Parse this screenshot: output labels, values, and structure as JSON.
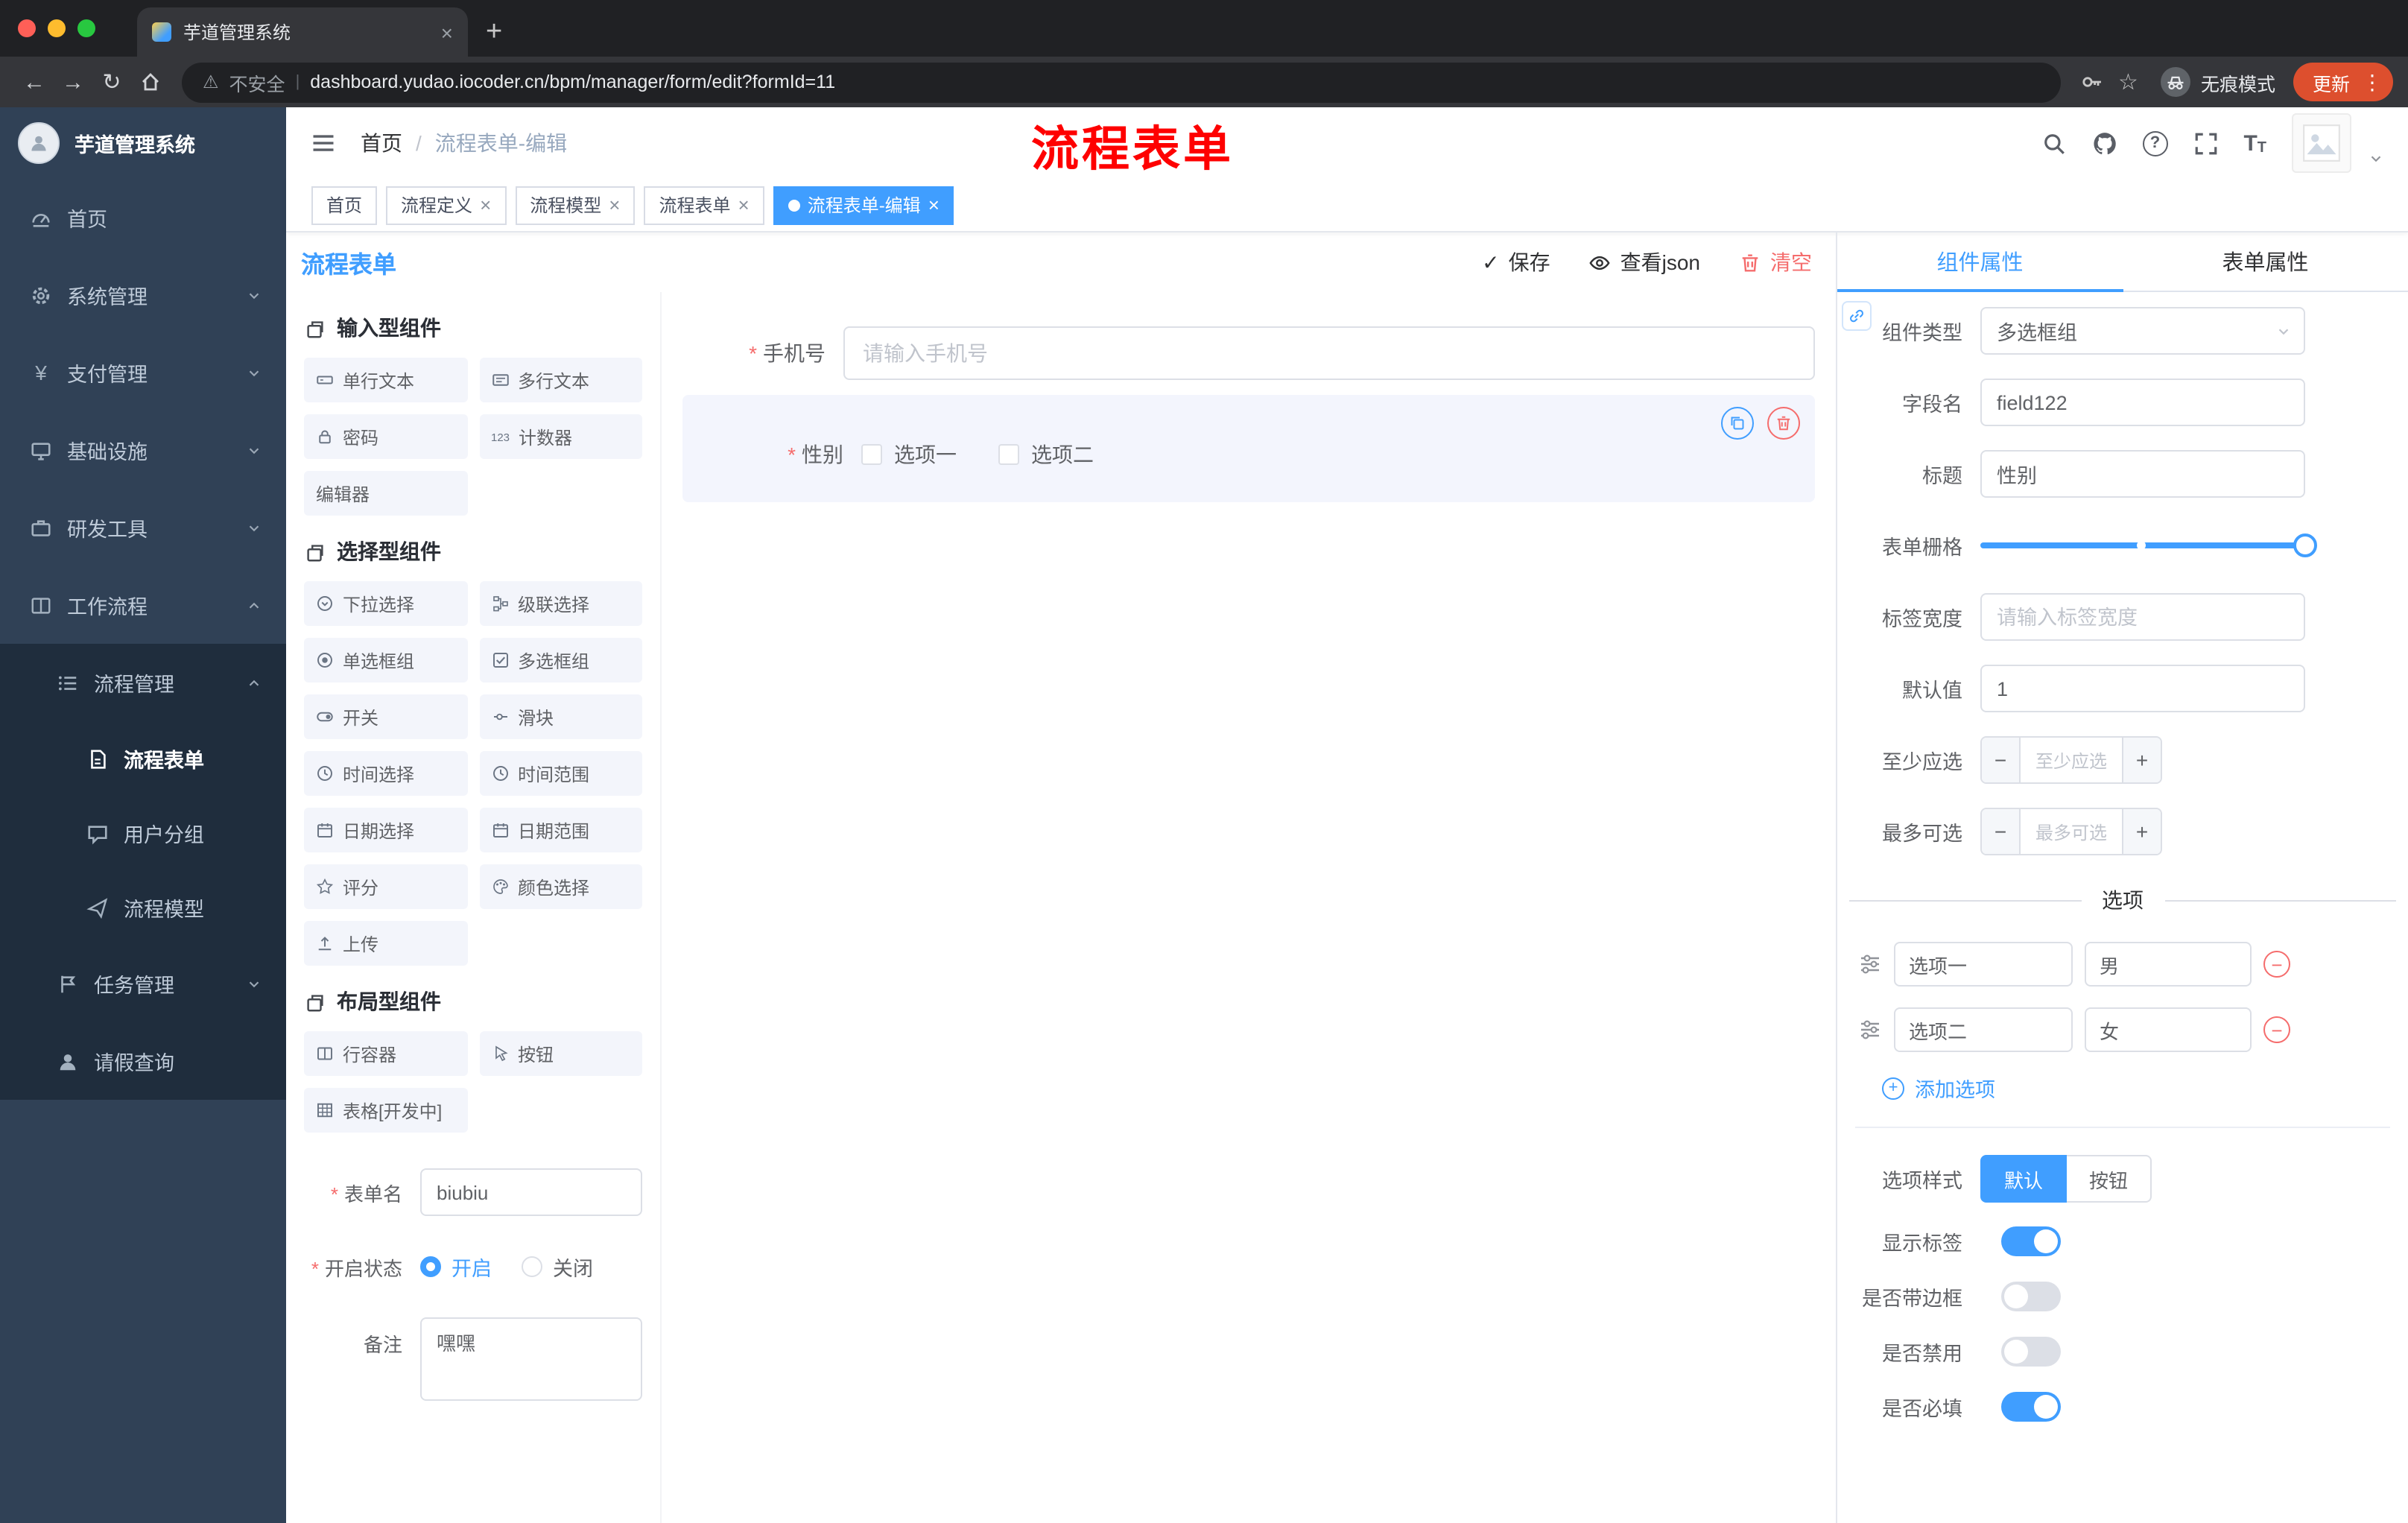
{
  "colors": {
    "accent": "#409eff",
    "danger": "#f56c6c",
    "annotation": "#ff0000",
    "sidebar_bg": "#304156",
    "update_badge": "#dd4f2e"
  },
  "browser": {
    "tab_title": "芋道管理系统",
    "security_label": "不安全",
    "url": "dashboard.yudao.iocoder.cn/bpm/manager/form/edit?formId=11",
    "incognito_label": "无痕模式",
    "update_label": "更新"
  },
  "sidebar": {
    "logo_title": "芋道管理系统",
    "items": [
      {
        "label": "首页"
      },
      {
        "label": "系统管理"
      },
      {
        "label": "支付管理"
      },
      {
        "label": "基础设施"
      },
      {
        "label": "研发工具"
      },
      {
        "label": "工作流程"
      }
    ],
    "submenu": {
      "process_mgmt": {
        "label": "流程管理",
        "children": [
          {
            "label": "流程表单"
          },
          {
            "label": "用户分组"
          },
          {
            "label": "流程模型"
          }
        ]
      },
      "task_mgmt": {
        "label": "任务管理"
      },
      "leave_query": {
        "label": "请假查询"
      }
    }
  },
  "header": {
    "breadcrumb": [
      "首页",
      "流程表单-编辑"
    ],
    "annotation": "流程表单"
  },
  "tags": [
    {
      "label": "首页",
      "closable": false,
      "active": false
    },
    {
      "label": "流程定义",
      "closable": true,
      "active": false
    },
    {
      "label": "流程模型",
      "closable": true,
      "active": false
    },
    {
      "label": "流程表单",
      "closable": true,
      "active": false
    },
    {
      "label": "流程表单-编辑",
      "closable": true,
      "active": true
    }
  ],
  "designer": {
    "title": "流程表单",
    "actions": {
      "save": "保存",
      "view_json": "查看json",
      "clear": "清空"
    },
    "palette": {
      "sections": [
        {
          "title": "输入型组件",
          "items": [
            "单行文本",
            "多行文本",
            "密码",
            "计数器",
            "编辑器"
          ]
        },
        {
          "title": "选择型组件",
          "items": [
            "下拉选择",
            "级联选择",
            "单选框组",
            "多选框组",
            "开关",
            "滑块",
            "时间选择",
            "时间范围",
            "日期选择",
            "日期范围",
            "评分",
            "颜色选择",
            "上传"
          ]
        },
        {
          "title": "布局型组件",
          "items": [
            "行容器",
            "按钮",
            "表格[开发中]"
          ]
        }
      ]
    },
    "form_meta": {
      "name_label": "表单名",
      "name_value": "biubiu",
      "status_label": "开启状态",
      "status_on": "开启",
      "status_off": "关闭",
      "remark_label": "备注",
      "remark_value": "嘿嘿"
    },
    "canvas": {
      "phone": {
        "label": "手机号",
        "placeholder": "请输入手机号",
        "required": true
      },
      "gender": {
        "label": "性别",
        "required": true,
        "options": [
          "选项一",
          "选项二"
        ]
      }
    }
  },
  "props": {
    "tabs": [
      "组件属性",
      "表单属性"
    ],
    "fields": {
      "type_label": "组件类型",
      "type_value": "多选框组",
      "field_label": "字段名",
      "field_value": "field122",
      "title_label": "标题",
      "title_value": "性别",
      "grid_label": "表单栅格",
      "label_width_label": "标签宽度",
      "label_width_placeholder": "请输入标签宽度",
      "default_label": "默认值",
      "default_value": "1",
      "min_label": "至少应选",
      "min_placeholder": "至少应选",
      "max_label": "最多可选",
      "max_placeholder": "最多可选"
    },
    "options_divider": "选项",
    "options": [
      {
        "label": "选项一",
        "value": "男"
      },
      {
        "label": "选项二",
        "value": "女"
      }
    ],
    "add_option": "添加选项",
    "style_label": "选项样式",
    "style_options": [
      "默认",
      "按钮"
    ],
    "switches": [
      {
        "label": "显示标签",
        "on": true
      },
      {
        "label": "是否带边框",
        "on": false
      },
      {
        "label": "是否禁用",
        "on": false
      },
      {
        "label": "是否必填",
        "on": true
      }
    ]
  }
}
